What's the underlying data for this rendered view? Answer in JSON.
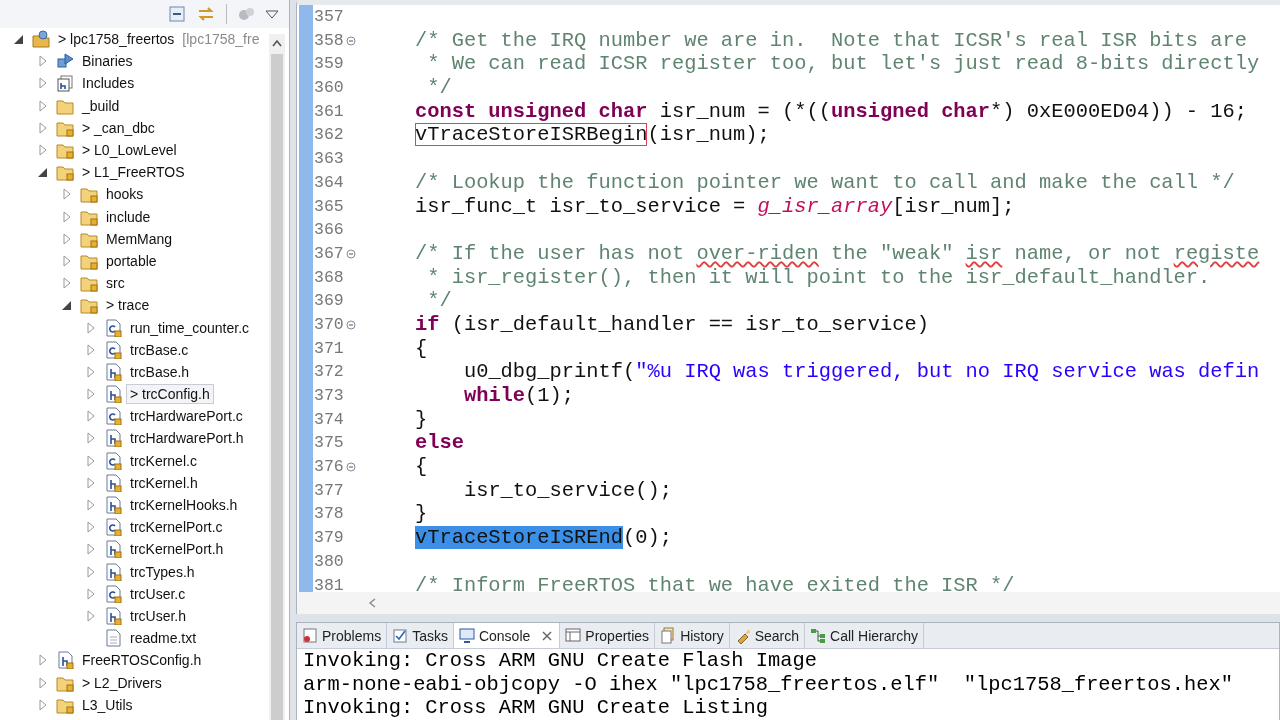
{
  "explorer": {
    "tree": [
      {
        "label": "> lpc1758_freertos",
        "suffix": "[lpc1758_fre",
        "kind": "project",
        "expanded": true,
        "selected": false,
        "children": [
          {
            "label": "Binaries",
            "kind": "binaries",
            "expanded": false,
            "selected": false
          },
          {
            "label": "Includes",
            "kind": "includes",
            "expanded": false,
            "selected": false
          },
          {
            "label": "_build",
            "kind": "folder",
            "expanded": false,
            "selected": false
          },
          {
            "label": "> _can_dbc",
            "kind": "source",
            "expanded": false,
            "selected": false
          },
          {
            "label": "> L0_LowLevel",
            "kind": "source",
            "expanded": false,
            "selected": false
          },
          {
            "label": "> L1_FreeRTOS",
            "kind": "source",
            "expanded": true,
            "selected": false,
            "children": [
              {
                "label": "hooks",
                "kind": "source",
                "expanded": false,
                "selected": false
              },
              {
                "label": "include",
                "kind": "source",
                "expanded": false,
                "selected": false
              },
              {
                "label": "MemMang",
                "kind": "source",
                "expanded": false,
                "selected": false
              },
              {
                "label": "portable",
                "kind": "source",
                "expanded": false,
                "selected": false
              },
              {
                "label": "src",
                "kind": "source",
                "expanded": false,
                "selected": false
              },
              {
                "label": "> trace",
                "kind": "source",
                "expanded": true,
                "selected": false,
                "children": [
                  {
                    "label": "run_time_counter.c",
                    "kind": "c",
                    "expanded": false,
                    "selected": false
                  },
                  {
                    "label": "trcBase.c",
                    "kind": "c",
                    "expanded": false,
                    "selected": false
                  },
                  {
                    "label": "trcBase.h",
                    "kind": "h",
                    "expanded": false,
                    "selected": false
                  },
                  {
                    "label": "> trcConfig.h",
                    "kind": "h",
                    "expanded": false,
                    "selected": true
                  },
                  {
                    "label": "trcHardwarePort.c",
                    "kind": "c",
                    "expanded": false,
                    "selected": false
                  },
                  {
                    "label": "trcHardwarePort.h",
                    "kind": "h",
                    "expanded": false,
                    "selected": false
                  },
                  {
                    "label": "trcKernel.c",
                    "kind": "c",
                    "expanded": false,
                    "selected": false
                  },
                  {
                    "label": "trcKernel.h",
                    "kind": "h",
                    "expanded": false,
                    "selected": false
                  },
                  {
                    "label": "trcKernelHooks.h",
                    "kind": "h",
                    "expanded": false,
                    "selected": false
                  },
                  {
                    "label": "trcKernelPort.c",
                    "kind": "c",
                    "expanded": false,
                    "selected": false
                  },
                  {
                    "label": "trcKernelPort.h",
                    "kind": "h",
                    "expanded": false,
                    "selected": false
                  },
                  {
                    "label": "trcTypes.h",
                    "kind": "h",
                    "expanded": false,
                    "selected": false
                  },
                  {
                    "label": "trcUser.c",
                    "kind": "c",
                    "expanded": false,
                    "selected": false
                  },
                  {
                    "label": "trcUser.h",
                    "kind": "h",
                    "expanded": false,
                    "selected": false
                  },
                  {
                    "label": "readme.txt",
                    "kind": "text",
                    "selected": false
                  }
                ]
              }
            ]
          },
          {
            "label": "FreeRTOSConfig.h",
            "kind": "h",
            "expanded": false,
            "selected": false
          },
          {
            "label": "> L2_Drivers",
            "kind": "source",
            "expanded": false,
            "selected": false
          },
          {
            "label": "L3_Utils",
            "kind": "source",
            "expanded": false,
            "selected": false
          }
        ]
      }
    ]
  },
  "editor": {
    "lines": [
      {
        "number": "357",
        "fold": false
      },
      {
        "number": "358",
        "fold": true,
        "kind": "level1",
        "tokens": [
          {
            "kind": "comment",
            "text": "/* Get the IRQ number we are in.  Note that ICSR's real ISR bits are"
          }
        ]
      },
      {
        "number": "359",
        "fold": false,
        "kind": "level1",
        "tokens": [
          {
            "kind": "comment",
            "text": " * We can read ICSR register too, but let's just read 8-bits directly"
          }
        ]
      },
      {
        "number": "360",
        "fold": false,
        "kind": "level1",
        "tokens": [
          {
            "kind": "comment",
            "text": " */"
          }
        ]
      },
      {
        "number": "361",
        "fold": false,
        "kind": "level1",
        "tokens": [
          {
            "kind": "keyword",
            "text": "const unsigned char"
          },
          {
            "kind": "plain",
            "text": " isr_num = (*(("
          },
          {
            "kind": "keyword",
            "text": "unsigned char"
          },
          {
            "kind": "plain",
            "text": "*) 0xE000ED04)) - 16;"
          }
        ]
      },
      {
        "number": "362",
        "fold": false,
        "kind": "level1",
        "tokens": [
          {
            "kind": "marked",
            "text": "vTraceStoreISRBegin"
          },
          {
            "kind": "plain",
            "text": "(isr_num);"
          }
        ]
      },
      {
        "number": "363",
        "fold": false
      },
      {
        "number": "364",
        "fold": false,
        "kind": "level1",
        "tokens": [
          {
            "kind": "comment",
            "text": "/* Lookup the function pointer we want to call and make the call */"
          }
        ]
      },
      {
        "number": "365",
        "fold": false,
        "kind": "level1",
        "tokens": [
          {
            "kind": "plain",
            "text": "isr_func_t isr_to_service = "
          },
          {
            "kind": "global",
            "text": "g_isr_array"
          },
          {
            "kind": "plain",
            "text": "[isr_num];"
          }
        ]
      },
      {
        "number": "366",
        "fold": false
      },
      {
        "number": "367",
        "fold": true,
        "kind": "level1",
        "tokens": [
          {
            "kind": "comment",
            "text": "/* If the user has not "
          },
          {
            "kind": "misspelled",
            "text": "over-riden"
          },
          {
            "kind": "comment",
            "text": " the \"weak\" "
          },
          {
            "kind": "misspelled",
            "text": "isr"
          },
          {
            "kind": "comment",
            "text": " name, or not "
          },
          {
            "kind": "misspelled",
            "text": "registe"
          }
        ]
      },
      {
        "number": "368",
        "fold": false,
        "kind": "level1",
        "tokens": [
          {
            "kind": "comment",
            "text": " * isr_register(), then it will point to the isr_default_handler."
          }
        ]
      },
      {
        "number": "369",
        "fold": false,
        "kind": "level1",
        "tokens": [
          {
            "kind": "comment",
            "text": " */"
          }
        ]
      },
      {
        "number": "370",
        "fold": true,
        "kind": "level1",
        "tokens": [
          {
            "kind": "keyword",
            "text": "if"
          },
          {
            "kind": "plain",
            "text": " (isr_default_handler == isr_to_service)"
          }
        ]
      },
      {
        "number": "371",
        "fold": false,
        "kind": "level1",
        "tokens": [
          {
            "kind": "plain",
            "text": "{"
          }
        ]
      },
      {
        "number": "372",
        "fold": false,
        "kind": "level2",
        "tokens": [
          {
            "kind": "plain",
            "text": "u0_dbg_printf("
          },
          {
            "kind": "string",
            "text": "\"%u IRQ was triggered, but no IRQ service was defin"
          }
        ]
      },
      {
        "number": "373",
        "fold": false,
        "kind": "level2",
        "tokens": [
          {
            "kind": "keyword",
            "text": "while"
          },
          {
            "kind": "plain",
            "text": "(1);"
          }
        ]
      },
      {
        "number": "374",
        "fold": false,
        "kind": "level1",
        "tokens": [
          {
            "kind": "plain",
            "text": "}"
          }
        ]
      },
      {
        "number": "375",
        "fold": false,
        "kind": "level1",
        "tokens": [
          {
            "kind": "keyword",
            "text": "else"
          }
        ]
      },
      {
        "number": "376",
        "fold": true,
        "kind": "level1",
        "tokens": [
          {
            "kind": "plain",
            "text": "{"
          }
        ]
      },
      {
        "number": "377",
        "fold": false,
        "kind": "level2",
        "tokens": [
          {
            "kind": "plain",
            "text": "isr_to_service();"
          }
        ]
      },
      {
        "number": "378",
        "fold": false,
        "kind": "level1",
        "tokens": [
          {
            "kind": "plain",
            "text": "}"
          }
        ]
      },
      {
        "number": "379",
        "fold": false,
        "kind": "level1",
        "tokens": [
          {
            "kind": "selected",
            "text": "vTraceStoreISREnd"
          },
          {
            "kind": "plain",
            "text": "(0);"
          }
        ]
      },
      {
        "number": "380",
        "fold": false
      },
      {
        "number": "381",
        "fold": false,
        "kind": "level1",
        "tokens": [
          {
            "kind": "comment",
            "text": "/* Inform FreeRTOS that we have exited the ISR */"
          }
        ]
      }
    ]
  },
  "bottom_panel": {
    "tabs": [
      {
        "label": "Problems",
        "selected": false
      },
      {
        "label": "Tasks",
        "selected": false
      },
      {
        "label": "Console",
        "selected": true
      },
      {
        "label": "Properties",
        "selected": false
      },
      {
        "label": "History",
        "selected": false
      },
      {
        "label": "Search",
        "selected": false
      },
      {
        "label": "Call Hierarchy",
        "selected": false
      }
    ],
    "console": [
      "Invoking: Cross ARM GNU Create Flash Image",
      "arm-none-eabi-objcopy -O ihex \"lpc1758_freertos.elf\"  \"lpc1758_freertos.hex\"",
      "Invoking: Cross ARM GNU Create Listing"
    ]
  }
}
